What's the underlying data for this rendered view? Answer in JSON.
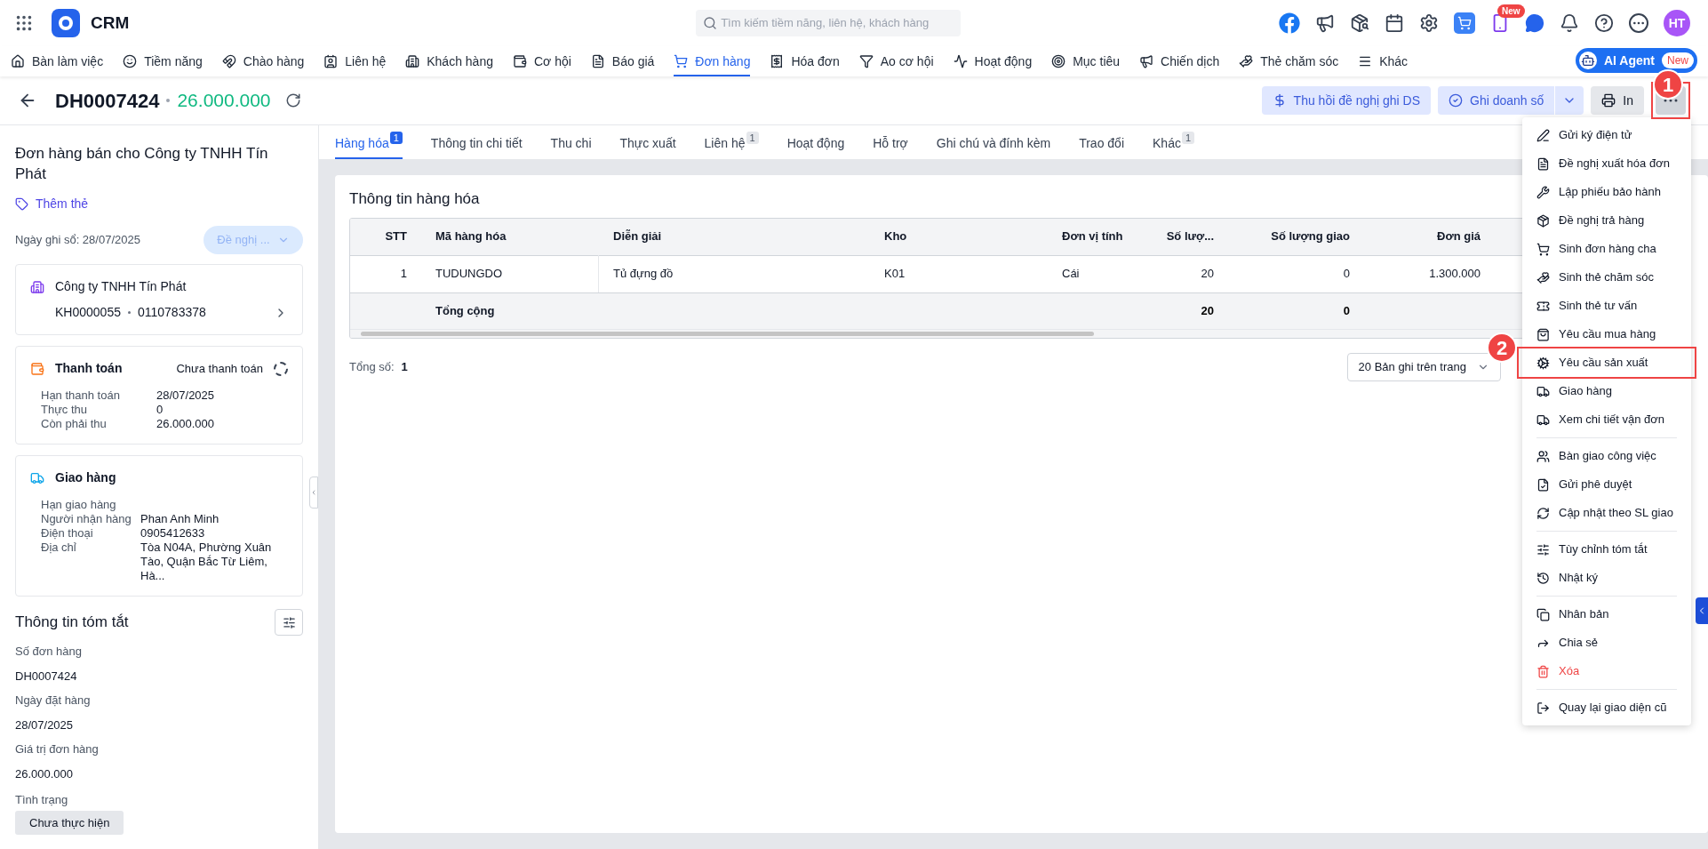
{
  "app": {
    "name": "CRM",
    "search_placeholder": "Tìm kiếm tiềm năng, liên hệ, khách hàng",
    "new_badge": "New",
    "avatar": "HT"
  },
  "nav": [
    {
      "label": "Bàn làm việc",
      "selected": false
    },
    {
      "label": "Tiềm năng",
      "selected": false
    },
    {
      "label": "Chào hàng",
      "selected": false
    },
    {
      "label": "Liên hệ",
      "selected": false
    },
    {
      "label": "Khách hàng",
      "selected": false
    },
    {
      "label": "Cơ hội",
      "selected": false
    },
    {
      "label": "Báo giá",
      "selected": false
    },
    {
      "label": "Đơn hàng",
      "selected": true
    },
    {
      "label": "Hóa đơn",
      "selected": false
    },
    {
      "label": "Ao cơ hội",
      "selected": false
    },
    {
      "label": "Hoạt động",
      "selected": false
    },
    {
      "label": "Mục tiêu",
      "selected": false
    },
    {
      "label": "Chiến dịch",
      "selected": false
    },
    {
      "label": "Thẻ chăm sóc",
      "selected": false
    },
    {
      "label": "Khác",
      "selected": false
    }
  ],
  "ai_agent": {
    "label": "AI Agent",
    "badge": "New"
  },
  "header": {
    "code": "DH0007424",
    "amount": "26.000.000",
    "buttons": [
      {
        "label": "Thu hồi đề nghị ghi DS"
      },
      {
        "label": "Ghi doanh số"
      },
      {
        "label": "In"
      }
    ],
    "more_marked": true,
    "more_badge": "1"
  },
  "sidebar": {
    "title": "Đơn hàng bán cho Công ty TNHH Tín Phát",
    "add_tag": "Thêm thẻ",
    "date": "Ngày ghi sổ: 28/07/2025",
    "status_button": "Đề nghị ...",
    "customer": {
      "name": "Công ty TNHH Tín Phát",
      "code": "KH0000055",
      "tax": "0110783378"
    },
    "payment": {
      "title": "Thanh toán",
      "status": "Chưa thanh toán",
      "rows": [
        {
          "label": "Hạn thanh toán",
          "value": "28/07/2025"
        },
        {
          "label": "Thực thu",
          "value": "0"
        },
        {
          "label": "Còn phải thu",
          "value": "26.000.000"
        }
      ]
    },
    "delivery": {
      "title": "Giao hàng",
      "rows": [
        {
          "label": "Hạn giao hàng",
          "value": ""
        },
        {
          "label": "Người nhận hàng",
          "value": "Phan Anh Minh"
        },
        {
          "label": "Điện thoại",
          "value": "0905412633"
        },
        {
          "label": "Địa chỉ",
          "value": "Tòa N04A, Phường Xuân Tào, Quận Bắc Từ Liêm, Hà..."
        }
      ]
    },
    "summary": {
      "title": "Thông tin tóm tắt",
      "fields": [
        {
          "label": "Số đơn hàng",
          "value": "DH0007424"
        },
        {
          "label": "Ngày đặt hàng",
          "value": "28/07/2025"
        },
        {
          "label": "Giá trị đơn hàng",
          "value": "26.000.000"
        }
      ],
      "status_label": "Tình trạng",
      "status_value": "Chưa thực hiện"
    }
  },
  "tabs": [
    {
      "label": "Hàng hóa",
      "selected": true,
      "count": "1"
    },
    {
      "label": "Thông tin chi tiết",
      "selected": false
    },
    {
      "label": "Thu chi",
      "selected": false
    },
    {
      "label": "Thực xuất",
      "selected": false
    },
    {
      "label": "Liên hệ",
      "selected": false,
      "count": "1"
    },
    {
      "label": "Hoạt động",
      "selected": false
    },
    {
      "label": "Hỗ trợ",
      "selected": false
    },
    {
      "label": "Ghi chú và đính kèm",
      "selected": false
    },
    {
      "label": "Trao đổi",
      "selected": false
    },
    {
      "label": "Khác",
      "selected": false,
      "count": "1"
    }
  ],
  "table": {
    "title": "Thông tin hàng hóa",
    "columns": [
      "STT",
      "Mã hàng hóa",
      "Diễn giải",
      "Kho",
      "Đơn vị tính",
      "Số lượ...",
      "Số lượng giao",
      "Đơn giá"
    ],
    "rows": [
      [
        "1",
        "TUDUNGDO",
        "Tủ đựng đồ",
        "K01",
        "Cái",
        "20",
        "0",
        "1.300.000"
      ]
    ],
    "total": {
      "label": "Tổng cộng",
      "quantity": "20",
      "delivered": "0"
    },
    "count_label": "Tổng số:",
    "count": "1",
    "page_size": "20 Bản ghi trên trang"
  },
  "menu": [
    [
      {
        "label": "Gửi ký điện tử",
        "kind": "normal",
        "marked": false
      },
      {
        "label": "Đề nghị xuất hóa đơn",
        "kind": "normal",
        "marked": false
      },
      {
        "label": "Lập phiếu bảo hành",
        "kind": "normal",
        "marked": false
      },
      {
        "label": "Đề nghị trả hàng",
        "kind": "normal",
        "marked": false
      },
      {
        "label": "Sinh đơn hàng cha",
        "kind": "normal",
        "marked": false
      },
      {
        "label": "Sinh thẻ chăm sóc",
        "kind": "normal",
        "marked": false
      },
      {
        "label": "Sinh thẻ tư vấn",
        "kind": "normal",
        "marked": false
      },
      {
        "label": "Yêu cầu mua hàng",
        "kind": "normal",
        "marked": false
      },
      {
        "label": "Yêu cầu sản xuất",
        "kind": "normal",
        "marked": true,
        "badge": "2"
      },
      {
        "label": "Giao hàng",
        "kind": "normal",
        "marked": false
      },
      {
        "label": "Xem chi tiết vận đơn",
        "kind": "normal",
        "marked": false
      }
    ],
    [
      {
        "label": "Bàn giao công việc",
        "kind": "normal",
        "marked": false
      },
      {
        "label": "Gửi phê duyệt",
        "kind": "normal",
        "marked": false
      },
      {
        "label": "Cập nhật theo SL giao",
        "kind": "normal",
        "marked": false
      }
    ],
    [
      {
        "label": "Tùy chỉnh tóm tắt",
        "kind": "normal",
        "marked": false
      },
      {
        "label": "Nhật ký",
        "kind": "normal",
        "marked": false
      }
    ],
    [
      {
        "label": "Nhân bản",
        "kind": "normal",
        "marked": false
      },
      {
        "label": "Chia sẻ",
        "kind": "normal",
        "marked": false
      },
      {
        "label": "Xóa",
        "kind": "danger",
        "marked": false
      }
    ],
    [
      {
        "label": "Quay lại giao diện cũ",
        "kind": "normal",
        "marked": false
      }
    ]
  ]
}
